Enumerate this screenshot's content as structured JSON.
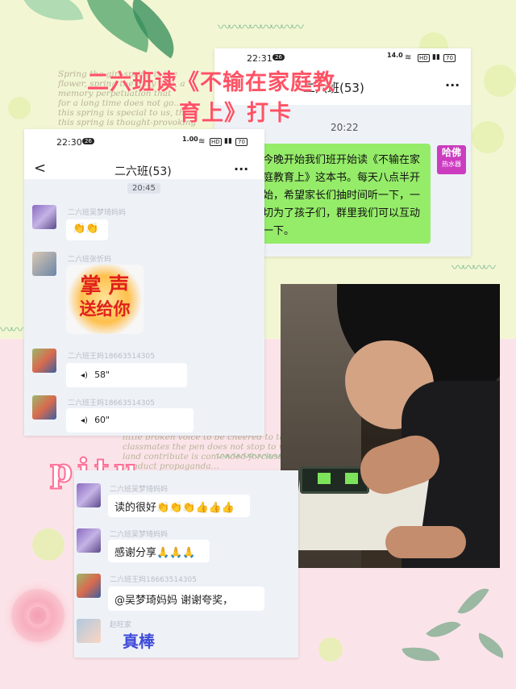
{
  "title": {
    "line1": "二六班读《不输在家庭教",
    "line2": "育上》打卡"
  },
  "paper_text": {
    "top": "Spring the girl spring is the\nflower, spring the fairy tale, a\nmemory perpetuation that\nfor a long time does not go...\nthis spring is special to us, thi\nthis spring is thought-provoking",
    "bottom": "little broken voice to be cheered to tears\nclassmates the pen does not stop to writ\nland contribute is contended forclass of\nconduct propaganda..."
  },
  "watermark": "pitu",
  "screenshot_back": {
    "status": {
      "time": "22:31",
      "badge": "26",
      "speed": "14.0",
      "speed_unit": "KB/S",
      "icons": "◉ ≋ HD ▮▮ ",
      "battery": "70"
    },
    "header": {
      "title": "二六班(53)",
      "more": "···"
    },
    "time_divider": "20:22",
    "message": {
      "text": "今晚开始我们班开始读《不输在家庭教育上》这本书。每天八点半开始，希望家长们抽时间听一下，一切为了孩子们，群里我们可以互动一下。",
      "avatar_text": "哈佛",
      "avatar_sub": "热水器"
    }
  },
  "screenshot_front": {
    "status": {
      "time": "22:30",
      "badge": "26",
      "speed": "1.00",
      "speed_unit": "KB/S",
      "battery": "70"
    },
    "header": {
      "back": "<",
      "title": "二六班(53)",
      "more": "···"
    },
    "time_divider": "20:45",
    "messages": [
      {
        "name": "二六班吴梦琦妈妈",
        "text": "👏👏"
      },
      {
        "name": "二六班张忻妈",
        "sticker_line1": "掌 声",
        "sticker_line2": "送给你"
      },
      {
        "name": "二六班王妈18663514305",
        "voice": "58\""
      },
      {
        "name": "二六班王妈18663514305",
        "voice": "60\""
      }
    ]
  },
  "screenshot_lower": {
    "messages": [
      {
        "name": "二六班吴梦琦妈妈",
        "text": "读的很好👏👏👏👍👍👍"
      },
      {
        "name": "二六班吴梦琦妈妈",
        "text": "感谢分享🙏🙏🙏"
      },
      {
        "name": "二六班王妈18663514305",
        "text": "@吴梦琦妈妈  谢谢夸奖，"
      },
      {
        "name": "赵旺家",
        "sticker": "真棒"
      }
    ]
  },
  "colors": {
    "title": "#ff5264",
    "bubble_green": "#95ec69",
    "accent_purple": "#cc3cbf"
  }
}
